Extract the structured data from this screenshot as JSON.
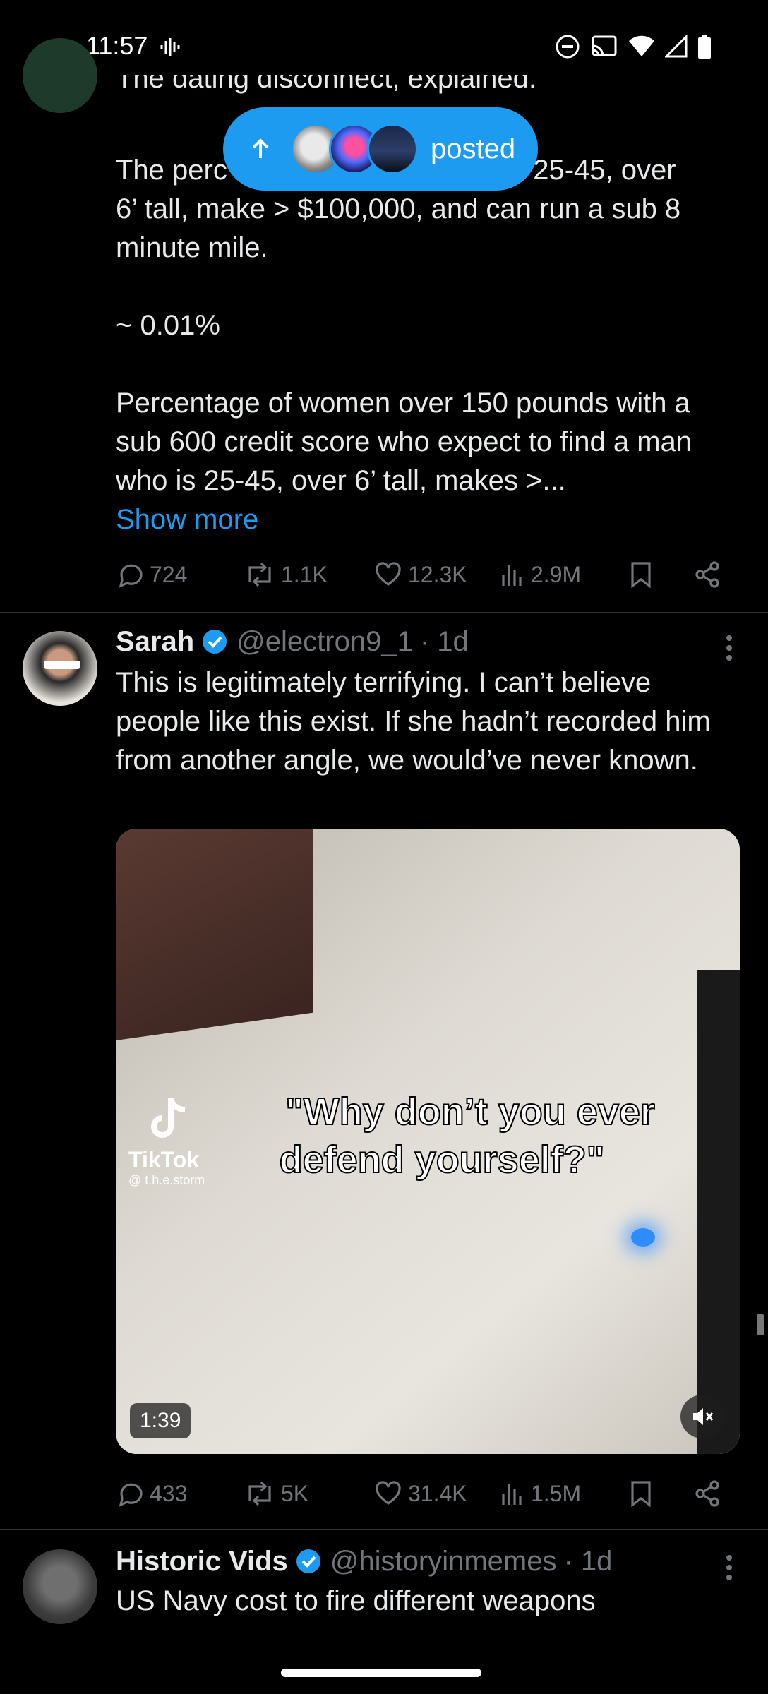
{
  "status_bar": {
    "time": "11:57"
  },
  "posted_pill": {
    "label": "posted"
  },
  "post1": {
    "title_partial": "The dating disconnect, explained.",
    "text_line1_left": "The perc",
    "text_line1_right": "e 25-45, over",
    "text_rest": "6’ tall, make > $100,000, and can run a sub 8 minute mile.\n\n~ 0.01%\n\nPercentage of women over 150 pounds with a sub 600 credit score who expect to find a man who is 25-45, over 6’ tall, makes >...",
    "show_more": "Show more",
    "replies": "724",
    "reposts": "1.1K",
    "likes": "12.3K",
    "views": "2.9M"
  },
  "post2": {
    "name": "Sarah",
    "handle": "@electron9_1",
    "time": "· 1d",
    "text": "This is legitimately terrifying. I can’t believe people like this exist. If she hadn’t recorded him from another angle, we would’ve never known.",
    "video": {
      "caption_line1": "\"Why don’t you ever",
      "caption_line2": "defend yourself?\"",
      "watermark": "TikTok",
      "watermark_handle": "@ t.h.e.storm",
      "duration": "1:39"
    },
    "replies": "433",
    "reposts": "5K",
    "likes": "31.4K",
    "views": "1.5M"
  },
  "post3": {
    "name": "Historic Vids",
    "handle": "@historyinmemes",
    "time": "· 1d",
    "text": "US Navy cost to fire different weapons"
  },
  "colors": {
    "accent": "#1d9bf0",
    "muted": "#71767b",
    "text": "#e7e9ea",
    "background": "#000000"
  }
}
